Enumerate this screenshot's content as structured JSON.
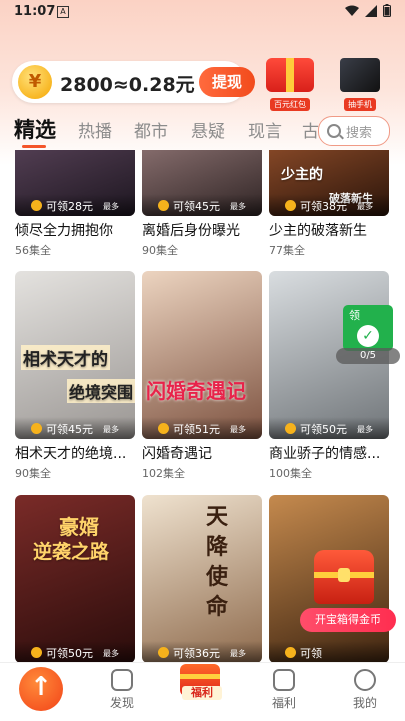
{
  "status_bar": {
    "time": "11:07",
    "app_badge": "A"
  },
  "header": {
    "coin_balance": "2800≈0.28元",
    "coin_symbol": "¥",
    "withdraw_label": "提现",
    "promo_red_packet": "百元红包",
    "promo_phone": "抽手机"
  },
  "tabs": [
    {
      "label": "精选",
      "active": true
    },
    {
      "label": "热播"
    },
    {
      "label": "都市"
    },
    {
      "label": "悬疑"
    },
    {
      "label": "现言"
    },
    {
      "label": "古"
    }
  ],
  "search": {
    "placeholder": "搜索"
  },
  "row1": [
    {
      "title": "倾尽全力拥抱你",
      "episodes": "56集全",
      "reward": "可领28元",
      "reward_suffix": "最多",
      "bg": "#2c2234"
    },
    {
      "title": "离婚后身份曝光",
      "episodes": "90集全",
      "reward": "可领45元",
      "reward_suffix": "最多",
      "bg": "#4a3a38"
    },
    {
      "title": "少主的破落新生",
      "episodes": "77集全",
      "reward": "可领38元",
      "reward_suffix": "最多",
      "overlay": "少主的",
      "overlay2": "破落新生",
      "bg": "#5a2f1c"
    }
  ],
  "row2": [
    {
      "title": "相术天才的绝境...",
      "episodes": "90集全",
      "reward": "可领45元",
      "reward_suffix": "最多",
      "overlay": "相术天才的",
      "overlay2": "绝境突围",
      "bg": "#c9c7c4"
    },
    {
      "title": "闪婚奇遇记",
      "episodes": "102集全",
      "reward": "可领51元",
      "reward_suffix": "最多",
      "overlay": "闪婚奇遇记",
      "bg": "#c8a48e"
    },
    {
      "title": "商业骄子的情感...",
      "episodes": "100集全",
      "reward": "可领50元",
      "reward_suffix": "最多",
      "bg": "#b8bec4"
    }
  ],
  "row3": [
    {
      "title": "",
      "episodes": "",
      "reward": "可领50元",
      "reward_suffix": "最多",
      "overlay": "豪婿",
      "overlay2": "逆袭之路",
      "bg": "#5e2322"
    },
    {
      "title": "",
      "episodes": "",
      "reward": "可领36元",
      "reward_suffix": "最多",
      "overlay": "天降使命",
      "bg": "#d7bfa3"
    },
    {
      "title": "",
      "episodes": "",
      "reward": "可领",
      "reward_suffix": "",
      "bg": "#8a5a2e"
    }
  ],
  "task_widget": {
    "label": "领",
    "progress": "0/5"
  },
  "chest_widget": {
    "label": "开宝箱得金币"
  },
  "bottom_nav": [
    {
      "label": "发现"
    },
    {
      "label": "福利"
    },
    {
      "label": "福利"
    },
    {
      "label": "我的"
    }
  ],
  "colors": {
    "accent": "#f4552a",
    "bg_top": "#fbd2c4"
  }
}
